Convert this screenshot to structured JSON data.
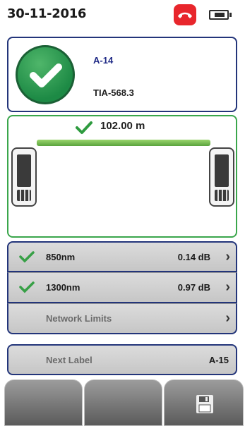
{
  "status": {
    "date": "30-11-2016",
    "phone_icon": "phone-hangup-icon",
    "battery_icon": "battery-icon"
  },
  "result": {
    "id": "A-14",
    "standard": "TIA-568.3",
    "status_icon": "check-circle-icon"
  },
  "diagram": {
    "length": "102.00 m"
  },
  "measurements": [
    {
      "name": "850nm",
      "value": "0.14 dB"
    },
    {
      "name": "1300nm",
      "value": "0.97 dB"
    }
  ],
  "limits": {
    "label": "Network Limits"
  },
  "next_label": {
    "label": "Next Label",
    "value": "A-15"
  },
  "buttons": {
    "save_icon": "save-icon"
  },
  "colors": {
    "accent": "#23357a",
    "pass": "#1d8a45",
    "fail": "#e8262c"
  }
}
